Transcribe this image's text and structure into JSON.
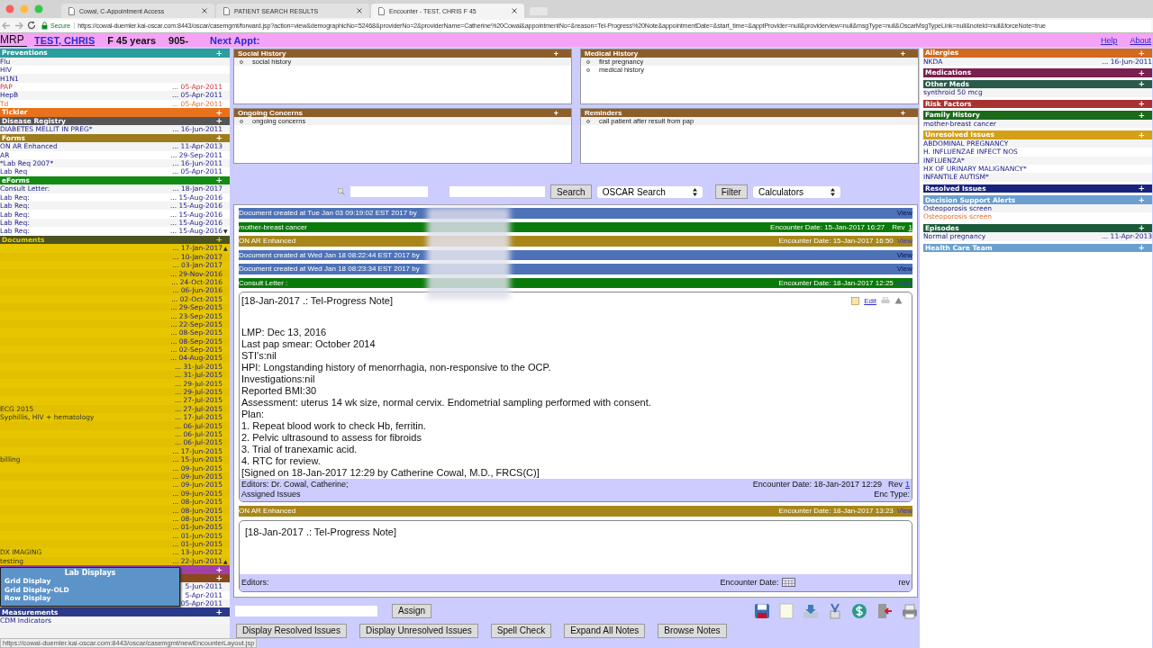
{
  "browser": {
    "tabs": [
      {
        "title": "Cowal, C-Appointment Access",
        "selected": false
      },
      {
        "title": "PATIENT SEARCH RESULTS",
        "selected": false
      },
      {
        "title": "Encounter - TEST, CHRIS F 45",
        "selected": true
      }
    ],
    "secure": "Secure",
    "url": "https://cowal-duemler.kai-oscar.com:8443/oscar/casemgmt/forward.jsp?action=view&demographicNo=52468&providerNo=2&providerName=Catherine%20Cowal&appointmentNo=&reason=Tel-Progress%20Note&appointmentDate=&start_time=&apptProvider=null&providerview=null&msgType=null&OscarMsgTypeLink=null&noteId=null&forceNote=true"
  },
  "header": {
    "mrp": "MRP",
    "patient": "TEST, CHRIS",
    "sex_age": "F 45 years",
    "phone": "905-",
    "next_appt": "Next Appt:",
    "links": [
      "Help",
      "About"
    ]
  },
  "left_sections": [
    {
      "kind": "list",
      "title": "Preventions",
      "color": "#2a9d9d",
      "add": "+",
      "items": [
        {
          "label": "Flu",
          "overdue": false,
          "pending": false
        },
        {
          "label": "HIV",
          "overdue": false,
          "pending": false
        },
        {
          "label": "H1N1",
          "overdue": false,
          "pending": false
        },
        {
          "label": "PAP",
          "date": "... 05-Apr-2011",
          "overdue": true,
          "pending": false
        },
        {
          "label": "HepB",
          "date": "... 05-Apr-2011",
          "overdue": false,
          "pending": false
        },
        {
          "label": "Td",
          "date": "... 05-Apr-2011",
          "overdue": false,
          "pending": true
        }
      ]
    },
    {
      "kind": "list",
      "title": "Tickler",
      "color": "#e8721c",
      "add": "+"
    },
    {
      "kind": "list",
      "title": "Disease Registry",
      "color": "#555555",
      "add": "+",
      "items": [
        {
          "label": "DIABETES MELLIT IN PREG*",
          "date": "... 16-Jun-2011"
        }
      ]
    },
    {
      "kind": "list",
      "title": "Forms",
      "color": "#9c7c1c",
      "add": "+",
      "items": [
        {
          "label": "ON AR Enhanced",
          "date": "... 11-Apr-2013"
        },
        {
          "label": "AR",
          "date": "... 29-Sep-2011"
        },
        {
          "label": "*Lab Req 2007*",
          "date": "... 16-Jun-2011"
        },
        {
          "label": "Lab Req",
          "date": "... 05-Apr-2011"
        }
      ]
    },
    {
      "kind": "list",
      "title": "eForms",
      "color": "#138a13",
      "add": "+",
      "items": [
        {
          "label": "Consult Letter:",
          "date": "... 18-Jan-2017"
        },
        {
          "label": "Lab Req:",
          "date": "... 15-Aug-2016"
        },
        {
          "label": "Lab Req:",
          "date": "... 15-Aug-2016"
        },
        {
          "label": "Lab Req:",
          "date": "... 15-Aug-2016"
        },
        {
          "label": "Lab Req:",
          "date": "... 15-Aug-2016"
        },
        {
          "label": "Lab Req:",
          "date": "... 15-Aug-2016",
          "arrow": "▼"
        }
      ]
    },
    {
      "kind": "documents",
      "title": "Documents",
      "color": "#4b5320",
      "add": "+",
      "items": [
        {
          "date": "... 17-Jan-2017",
          "arrow": "▲"
        },
        {
          "date": "... 10-Jan-2017"
        },
        {
          "date": "... 03-Jan-2017"
        },
        {
          "date": "... 29-Nov-2016"
        },
        {
          "date": "... 24-Oct-2016"
        },
        {
          "date": "... 06-Jun-2016"
        },
        {
          "date": "... 02-Oct-2015"
        },
        {
          "date": "... 29-Sep-2015"
        },
        {
          "date": "... 23-Sep-2015"
        },
        {
          "date": "... 22-Sep-2015"
        },
        {
          "date": "... 08-Sep-2015"
        },
        {
          "date": "... 08-Sep-2015"
        },
        {
          "date": "... 02-Sep-2015"
        },
        {
          "date": "... 04-Aug-2015"
        },
        {
          "date": "... 31-Jul-2015"
        },
        {
          "date": "... 31-Jul-2015"
        },
        {
          "date": "... 29-Jul-2015"
        },
        {
          "date": "... 29-Jul-2015"
        },
        {
          "date": "... 27-Jul-2015"
        },
        {
          "label": "ECG 2015",
          "date": "... 27-Jul-2015"
        },
        {
          "label": "Syphillis, HIV + hematology",
          "date": "... 17-Jul-2015"
        },
        {
          "date": "... 06-Jul-2015"
        },
        {
          "date": "... 06-Jul-2015"
        },
        {
          "date": "... 06-Jul-2015"
        },
        {
          "date": "... 17-Jun-2015"
        },
        {
          "label": "billing",
          "date": "... 15-Jun-2015"
        },
        {
          "date": "... 09-Jun-2015"
        },
        {
          "date": "... 09-Jun-2015"
        },
        {
          "date": "... 09-Jun-2015"
        },
        {
          "date": "... 09-Jun-2015"
        },
        {
          "date": "... 08-Jun-2015"
        },
        {
          "date": "... 08-Jun-2015"
        },
        {
          "date": "... 08-Jun-2015"
        },
        {
          "date": "... 01-Jun-2015"
        },
        {
          "date": "... 01-Jun-2015"
        },
        {
          "date": "... 01-Jun-2015"
        },
        {
          "label": "DX IMAGING",
          "date": "... 13-Jun-2012"
        },
        {
          "label": "testing",
          "date": "... 22-Jun-2011",
          "arrow": "▲"
        }
      ]
    },
    {
      "kind": "list",
      "color": "#a040a8",
      "add": "+"
    },
    {
      "kind": "list",
      "color": "#8a4a1c",
      "add": "+",
      "items": [
        {
          "date": "5-Jun-2011"
        },
        {
          "date": "5-Apr-2011"
        },
        {
          "date": "05-Apr-2011"
        }
      ]
    },
    {
      "kind": "list",
      "title": "Measurements",
      "color": "#2a3a8a",
      "add": "+",
      "items": [
        {
          "label": "CDM Indicators"
        }
      ]
    }
  ],
  "lab_popup": {
    "title": "Lab Displays",
    "items": [
      "Grid Display",
      "Grid Display-OLD",
      "Row Display"
    ]
  },
  "status_url": "https://cowal-duemler.kai-oscar.com:8443/oscar/casemgmt/newEncounterLayout.jsp",
  "summary_boxes": [
    {
      "title": "Social History",
      "add": "+",
      "items": [
        "social history"
      ]
    },
    {
      "title": "Medical History",
      "add": "+",
      "items": [
        "first pregnancy",
        "medical history"
      ]
    },
    {
      "title": "Ongoing Concerns",
      "add": "+",
      "items": [
        "ongoing concerns"
      ]
    },
    {
      "title": "Reminders",
      "add": "+",
      "items": [
        "call patient after result from pap"
      ]
    }
  ],
  "search": {
    "search_button": "Search",
    "search_select": "OSCAR Search",
    "filter_button": "Filter",
    "calc_select": "Calculators"
  },
  "notes": [
    {
      "kind": "document",
      "left": "Document created at Tue Jan 03 09:19:02 EST 2017 by",
      "link": "View"
    },
    {
      "kind": "encounter",
      "left": "mother-breast cancer",
      "right": "Encounter Date:  15-Jan-2017 16:27",
      "rev": "Rev",
      "rev_link": "1"
    },
    {
      "kind": "form",
      "left": "ON AR Enhanced",
      "right": "Encounter Date:  15-Jan-2017 16:50",
      "link": "View"
    },
    {
      "kind": "document",
      "left": "Document created at Wed Jan 18 08:22:44 EST 2017 by",
      "link": "View"
    },
    {
      "kind": "document",
      "left": "Document created at Wed Jan 18 08:23:34 EST 2017 by",
      "link": "View"
    },
    {
      "kind": "encounter",
      "left": "Consult Letter :",
      "right": "Encounter Date:  18-Jan-2017 12:25",
      "link": "View"
    }
  ],
  "note_card": {
    "title": "[18-Jan-2017 .: Tel-Progress Note]",
    "edit": "Edit",
    "lines": [
      "LMP: Dec 13, 2016",
      "Last pap smear: October 2014",
      "STI's:nil",
      "HPI: Longstanding history of menorrhagia, non-responsive to the OCP.",
      "Investigations:nil",
      "Reported BMI:30",
      "Assessment: uterus 14 wk size, normal cervix. Endometrial sampling performed with consent.",
      "Plan:",
      "1. Repeat blood work to check Hb, ferritin.",
      "2. Pelvic ultrasound to assess for fibroids",
      "3. Trial of tranexamic acid.",
      "4. RTC for review.",
      "[Signed on 18-Jan-2017 12:29 by Catherine Cowal, M.D., FRCS(C)]"
    ],
    "editors": "Editors: Dr. Cowal, Catherine;",
    "encounter": "Encounter Date:  18-Jan-2017 12:29",
    "rev": "Rev",
    "rev_link": "1",
    "issues": "Assigned Issues",
    "enc_type": "Enc Type:"
  },
  "after_bar": {
    "kind": "form",
    "left": "ON AR Enhanced",
    "right": "Encounter Date:  18-Jan-2017 13:23",
    "link": "View"
  },
  "new_note": {
    "text": "[18-Jan-2017 .: Tel-Progress Note]",
    "editors": "Editors:",
    "encounter": "Encounter Date:",
    "rev": "rev"
  },
  "assign_button": "Assign",
  "buttons": [
    "Display Resolved Issues",
    "Display Unresolved Issues",
    "Spell Check",
    "Expand All Notes",
    "Browse Notes"
  ],
  "right_sections": [
    {
      "title": "Allergies",
      "color": "#d2691e",
      "add": "+",
      "items": [
        {
          "label": "NKDA",
          "date": "... 16-Jun-2011"
        }
      ]
    },
    {
      "title": "Medications",
      "color": "#7a1f4f",
      "add": "+"
    },
    {
      "title": "Other Meds",
      "color": "#2a5a4a",
      "add": "+",
      "items": [
        {
          "label": "synthroid 50 mcg"
        }
      ]
    },
    {
      "title": "Risk Factors",
      "color": "#a83232",
      "add": "+"
    },
    {
      "title": "Family History",
      "color": "#1a6a1a",
      "add": "+",
      "items": [
        {
          "label": "mother-breast cancer"
        }
      ]
    },
    {
      "title": "Unresolved Issues",
      "color": "#d4a017",
      "add": "+",
      "items": [
        {
          "label": "ABDOMINAL PREGNANCY"
        },
        {
          "label": "H. INFLUENZAE INFECT NOS"
        },
        {
          "label": "INFLUENZA*"
        },
        {
          "label": "HX OF URINARY MALIGNANCY*"
        },
        {
          "label": "INFANTILE AUTISM*"
        }
      ]
    },
    {
      "title": "Resolved Issues",
      "color": "#1a237e",
      "add": "+"
    },
    {
      "title": "Decision Support Alerts",
      "color": "#6a9fd0",
      "add": "+",
      "items": [
        {
          "label": "Osteoporosis screen",
          "overdue": false,
          "pending": false
        },
        {
          "label": "Osteoporosis screen",
          "overdue": false,
          "pending": true
        }
      ]
    },
    {
      "title": "Episodes",
      "color": "#1a5a3a",
      "add": "+",
      "items": [
        {
          "label": "Normal pregnancy",
          "date": "... 11-Apr-2013"
        }
      ]
    },
    {
      "title": "Health Care Team",
      "color": "#6a9fd0",
      "add": "+"
    }
  ]
}
